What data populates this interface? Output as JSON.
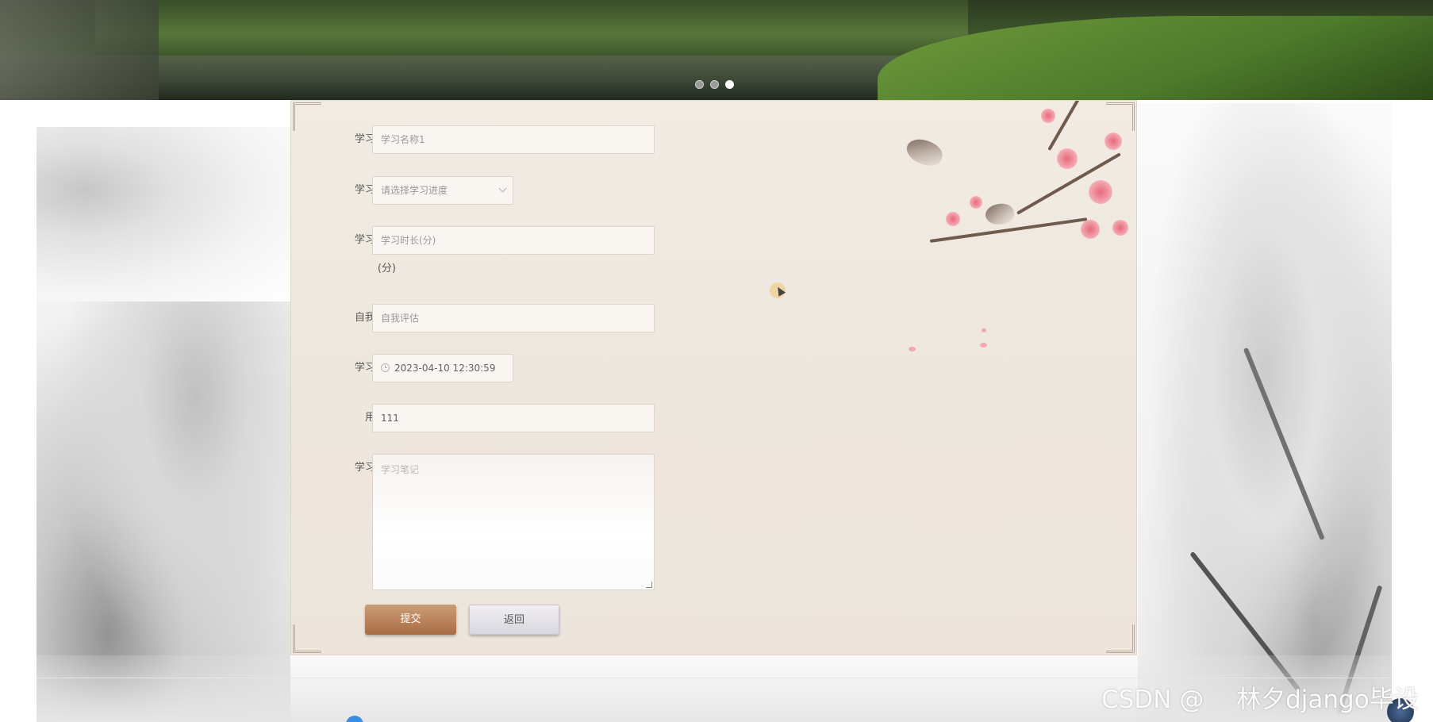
{
  "banner": {
    "slide_count": 3,
    "active_slide_index": 2
  },
  "form": {
    "fields": [
      {
        "label": "学习名称",
        "value": "学习名称1",
        "type": "text",
        "filled": false
      },
      {
        "label": "学习进度",
        "value": "请选择学习进度",
        "type": "select",
        "filled": false
      },
      {
        "label": "学习时长",
        "label_suffix": "(分)",
        "value": "学习时长(分)",
        "type": "text",
        "filled": false
      },
      {
        "label": "自我评估",
        "value": "自我评估",
        "type": "text",
        "filled": false
      },
      {
        "label": "学习时间",
        "value": "2023-04-10 12:30:59",
        "type": "datetime",
        "filled": true
      },
      {
        "label": "用户名",
        "value": "111",
        "type": "text",
        "filled": true
      },
      {
        "label": "学习笔记",
        "value": "学习笔记",
        "type": "textarea",
        "filled": false
      }
    ],
    "submit_label": "提交",
    "back_label": "返回"
  },
  "watermark": "CSDN @ 　林夕django毕设",
  "icons": {
    "select": "chevron-down-icon",
    "datetime": "clock-icon"
  }
}
